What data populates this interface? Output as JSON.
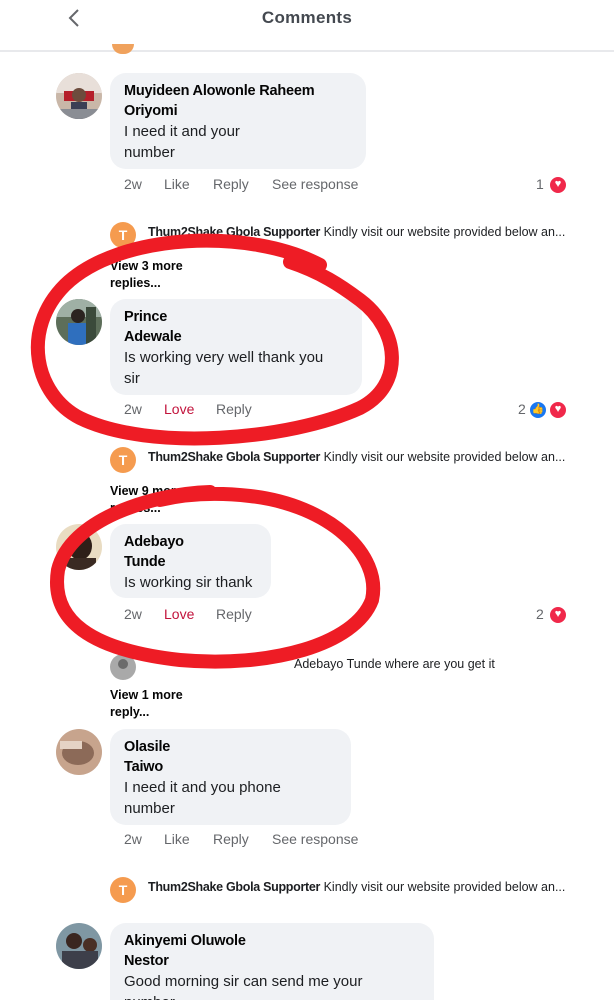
{
  "header": {
    "title": "Comments",
    "back_icon": "chevron-left-icon"
  },
  "accent": {
    "love": "#c2133c",
    "heart": "#f0284a",
    "like": "#1877f2",
    "annotation": "#ee1c25"
  },
  "comments": [
    {
      "name_line1": "Muyideen Alowonle Raheem",
      "name_line2": "Oriyomi",
      "text_line1": "I need it and your",
      "text_line2": "number",
      "time": "2w",
      "like": "Like",
      "reply": "Reply",
      "see_response": "See response",
      "reaction_count": "1"
    },
    {
      "name_line1": "Prince",
      "name_line2": "Adewale",
      "text_line1": "Is working very well thank you",
      "text_line2": "sir",
      "time": "2w",
      "like": "Love",
      "reply": "Reply",
      "reaction_count": "2"
    },
    {
      "name_line1": "Adebayo",
      "name_line2": "Tunde",
      "text_line1": "Is working sir thank",
      "time": "2w",
      "like": "Love",
      "reply": "Reply",
      "reaction_count": "2"
    },
    {
      "name_line1": "Olasile",
      "name_line2": "Taiwo",
      "text_line1": "I need it and you phone",
      "text_line2": "number",
      "time": "2w",
      "like": "Like",
      "reply": "Reply",
      "see_response": "See response"
    },
    {
      "name_line1": "Akinyemi Oluwole",
      "name_line2": "Nestor",
      "text_line1": "Good morning sir can send me your",
      "text_line2": "number"
    }
  ],
  "replies": [
    {
      "avatar_letter": "T",
      "author": "Thum2Shake Gbola Supporter",
      "text": "Kindly visit our website provided below an..."
    },
    {
      "avatar_letter": "T",
      "author": "Thum2Shake Gbola Supporter",
      "text": "Kindly visit our website provided below an..."
    },
    {
      "author": "",
      "text": "Adebayo Tunde where are you get it"
    },
    {
      "avatar_letter": "T",
      "author": "Thum2Shake Gbola Supporter",
      "text": "Kindly visit our website provided below an..."
    }
  ],
  "view_more": [
    {
      "line1": "View 3 more",
      "line2": "replies..."
    },
    {
      "line1": "View 9 more",
      "line2": "replies..."
    },
    {
      "line1": "View 1 more",
      "line2": "reply..."
    }
  ]
}
